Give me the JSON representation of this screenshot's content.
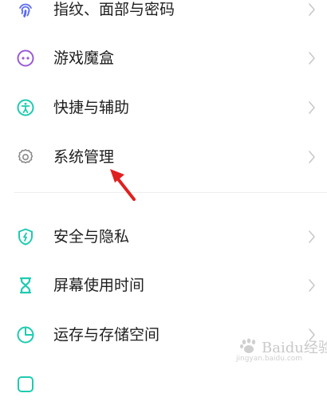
{
  "accent_color": "#1ecbb0",
  "settings_list": {
    "items": [
      {
        "label": "指纹、面部与密码",
        "icon": "fingerprint-icon",
        "icon_color": "#5b6cf0"
      },
      {
        "label": "游戏魔盒",
        "icon": "game-box-icon",
        "icon_color": "#9a5ad6"
      },
      {
        "label": "快捷与辅助",
        "icon": "accessibility-icon",
        "icon_color": "#1ecbb0"
      },
      {
        "label": "系统管理",
        "icon": "gear-icon",
        "icon_color": "#8a8a8a"
      },
      {
        "label": "安全与隐私",
        "icon": "shield-icon",
        "icon_color": "#1ecbb0"
      },
      {
        "label": "屏幕使用时间",
        "icon": "hourglass-icon",
        "icon_color": "#1ecbb0"
      },
      {
        "label": "运存与存储空间",
        "icon": "pie-chart-icon",
        "icon_color": "#1ecbb0"
      }
    ]
  },
  "annotation": {
    "icon": "red-arrow-icon",
    "color": "#e02020"
  },
  "watermark": {
    "text": "Baidu经验",
    "subtext": "jingyan.baidu.com"
  }
}
